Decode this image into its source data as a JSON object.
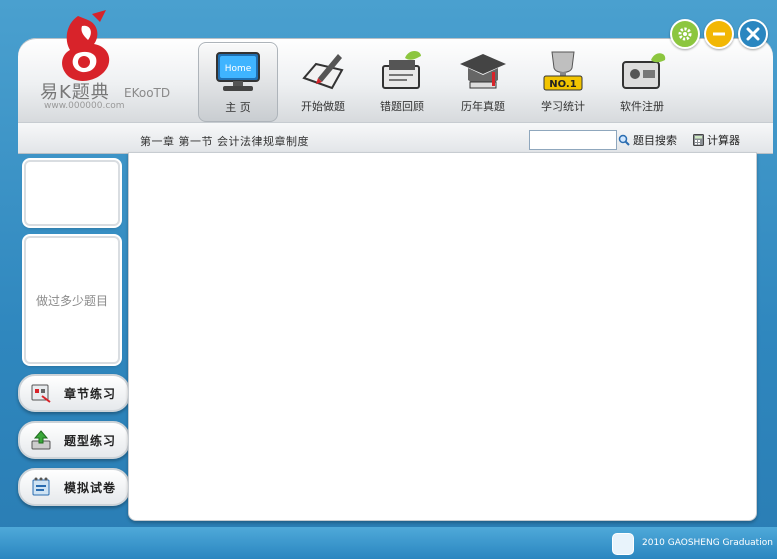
{
  "app": {
    "logo_title": "易K题典",
    "logo_subtitle": "EKooTD",
    "logo_url": "www.000000.com"
  },
  "window_controls": {
    "settings": "settings-icon",
    "minimize": "minimize-icon",
    "close": "close-icon"
  },
  "nav": {
    "items": [
      {
        "label": "主  页",
        "icon": "home-monitor-icon",
        "badge": "Home",
        "active": true
      },
      {
        "label": "开始做题",
        "icon": "pen-paper-icon"
      },
      {
        "label": "错题回顾",
        "icon": "review-book-icon"
      },
      {
        "label": "历年真题",
        "icon": "graduation-cap-icon"
      },
      {
        "label": "学习统计",
        "icon": "trophy-icon",
        "badge": "NO.1"
      },
      {
        "label": "软件注册",
        "icon": "register-icon"
      }
    ]
  },
  "toolbar": {
    "breadcrumb": "第一章  第一节  会计法律规章制度",
    "search_value": "",
    "search_label": "题目搜索",
    "calculator_label": "计算器"
  },
  "sidebar": {
    "stats_label": "做过多少题目",
    "buttons": [
      {
        "label": "章节练习",
        "icon": "chapter-practice-icon"
      },
      {
        "label": "题型练习",
        "icon": "question-type-icon"
      },
      {
        "label": "模拟试卷",
        "icon": "mock-exam-icon"
      }
    ]
  },
  "footer": {
    "text": "2010 GAOSHENG Graduation"
  },
  "colors": {
    "background": "#2f87be",
    "accent_green": "#8cc63f",
    "accent_yellow": "#f2b705",
    "accent_blue": "#2a86c0",
    "logo_red": "#d8232a"
  }
}
